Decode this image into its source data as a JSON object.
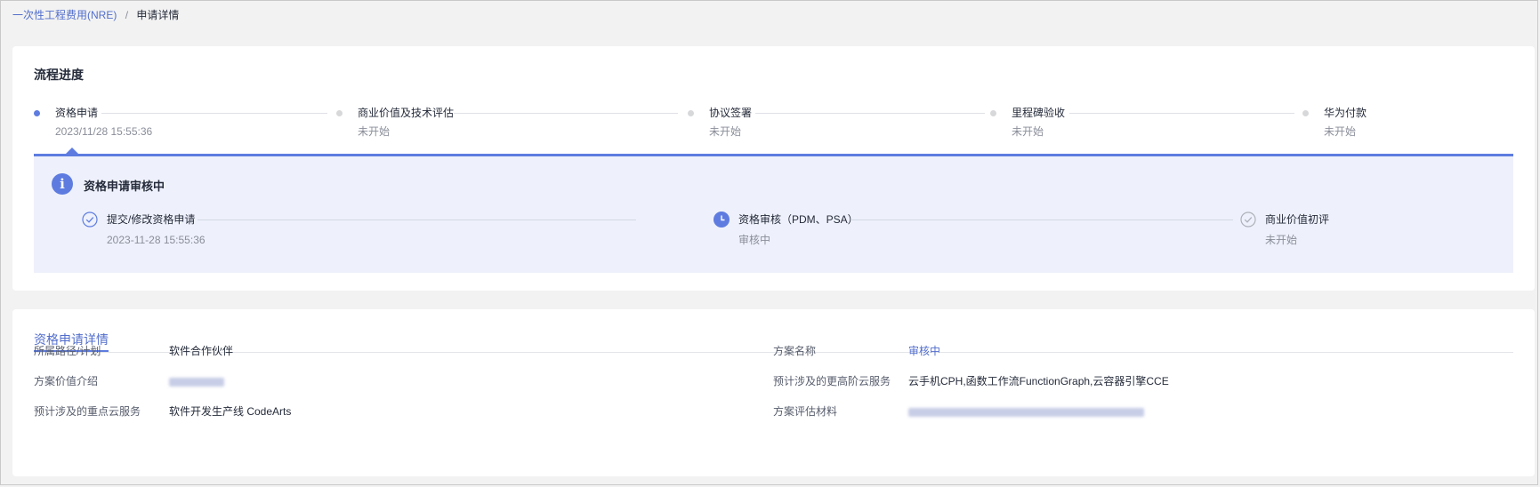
{
  "breadcrumb": {
    "parent": "一次性工程费用(NRE)",
    "separator": "/",
    "current": "申请详情"
  },
  "progress": {
    "title": "流程进度",
    "steps": [
      {
        "label": "资格申请",
        "sub": "2023/11/28 15:55:36",
        "state": "active"
      },
      {
        "label": "商业价值及技术评估",
        "sub": "未开始",
        "state": "pending"
      },
      {
        "label": "协议签署",
        "sub": "未开始",
        "state": "pending"
      },
      {
        "label": "里程碑验收",
        "sub": "未开始",
        "state": "pending"
      },
      {
        "label": "华为付款",
        "sub": "未开始",
        "state": "pending"
      }
    ],
    "panel": {
      "icon": "info-icon",
      "title": "资格申请审核中",
      "substeps": [
        {
          "label": "提交/修改资格申请",
          "sub": "2023-11-28 15:55:36",
          "state": "done",
          "icon": "check-circle-icon"
        },
        {
          "label": "资格审核（PDM、PSA）",
          "sub": "审核中",
          "state": "current",
          "icon": "clock-icon"
        },
        {
          "label": "商业价值初评",
          "sub": "未开始",
          "state": "pending",
          "icon": "check-circle-outline-icon"
        }
      ]
    }
  },
  "details": {
    "tab": "资格申请详情",
    "left": [
      {
        "key": "所属路径/计划",
        "value": "软件合作伙伴"
      },
      {
        "key": "方案价值介绍",
        "value": ""
      },
      {
        "key": "预计涉及的重点云服务",
        "value": "软件开发生产线 CodeArts"
      }
    ],
    "right": [
      {
        "key": "方案名称",
        "value": "审核中"
      },
      {
        "key": "预计涉及的更高阶云服务",
        "value": "云手机CPH,函数工作流FunctionGraph,云容器引擎CCE"
      },
      {
        "key": "方案评估材料",
        "value": ""
      }
    ]
  },
  "colors": {
    "accent": "#5e7ce0",
    "link": "#526ecc",
    "panel_bg": "#eef1fb",
    "page_bg": "#f2f2f2"
  }
}
